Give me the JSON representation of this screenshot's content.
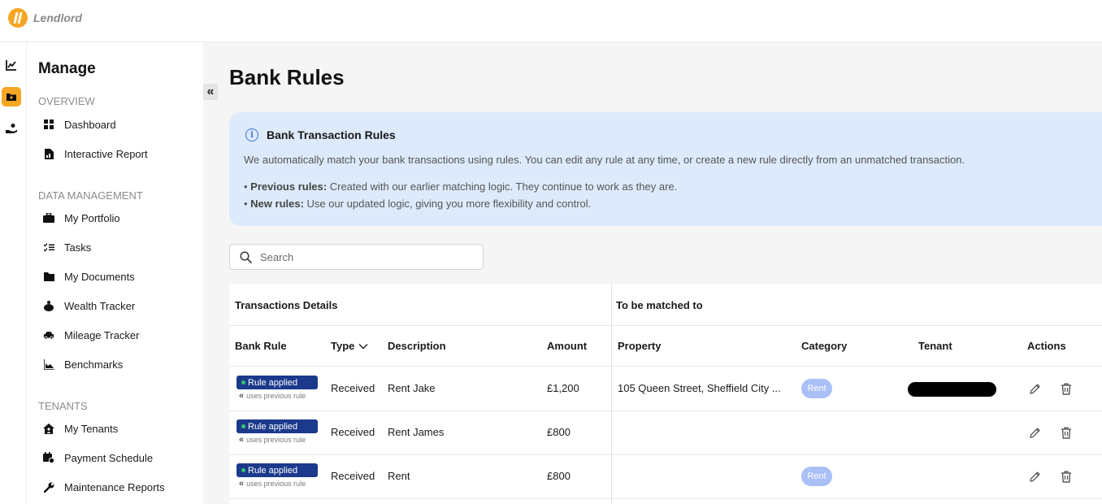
{
  "app": {
    "brand": "Lendlord",
    "brand_color": "#f5a623"
  },
  "rail": {
    "items": [
      {
        "icon": "chart-line-icon",
        "active": false
      },
      {
        "icon": "folder-icon",
        "active": true
      },
      {
        "icon": "hand-coin-icon",
        "active": false
      }
    ]
  },
  "sidebar": {
    "title": "Manage",
    "sections": [
      {
        "label": "OVERVIEW",
        "items": [
          {
            "label": "Dashboard",
            "icon": "grid-icon"
          },
          {
            "label": "Interactive Report",
            "icon": "report-icon"
          }
        ]
      },
      {
        "label": "DATA MANAGEMENT",
        "items": [
          {
            "label": "My Portfolio",
            "icon": "briefcase-icon"
          },
          {
            "label": "Tasks",
            "icon": "checklist-icon"
          },
          {
            "label": "My Documents",
            "icon": "folder-icon"
          },
          {
            "label": "Wealth Tracker",
            "icon": "piggy-bank-icon"
          },
          {
            "label": "Mileage Tracker",
            "icon": "car-icon"
          },
          {
            "label": "Benchmarks",
            "icon": "area-chart-icon"
          }
        ]
      },
      {
        "label": "TENANTS",
        "items": [
          {
            "label": "My Tenants",
            "icon": "home-user-icon"
          },
          {
            "label": "Payment Schedule",
            "icon": "calendar-icon"
          },
          {
            "label": "Maintenance Reports",
            "icon": "wrench-icon"
          }
        ]
      }
    ]
  },
  "collapse_icon": "«",
  "page": {
    "title": "Bank Rules"
  },
  "info": {
    "icon_glyph": "i",
    "title": "Bank Transaction Rules",
    "description": "We automatically match your bank transactions using rules. You can edit any rule at any time, or create a new rule directly from an unmatched transaction.",
    "bullets": [
      {
        "label": "Previous rules:",
        "text": "Created with our earlier matching logic. They continue to work as they are."
      },
      {
        "label": "New rules:",
        "text": "Use our updated logic, giving you more flexibility and control."
      }
    ]
  },
  "search": {
    "placeholder": "Search"
  },
  "table": {
    "group_left": "Transactions Details",
    "group_right": "To be matched to",
    "columns": {
      "bank_rule": "Bank Rule",
      "type": "Type",
      "description": "Description",
      "amount": "Amount",
      "property": "Property",
      "category": "Category",
      "tenant": "Tenant",
      "actions": "Actions"
    },
    "rows": [
      {
        "badge": "Rule applied",
        "sub": "uses previous rule",
        "type": "Received",
        "description": "Rent Jake",
        "amount": "£1,200",
        "property": "105 Queen Street, Sheffield City ...",
        "category": "Rent",
        "tenant_redacted": true
      },
      {
        "badge": "Rule applied",
        "sub": "uses previous rule",
        "type": "Received",
        "description": "Rent James",
        "amount": "£800",
        "property": "",
        "category": "",
        "tenant_redacted": false
      },
      {
        "badge": "Rule applied",
        "sub": "uses previous rule",
        "type": "Received",
        "description": "Rent",
        "amount": "£800",
        "property": "",
        "category": "Rent",
        "tenant_redacted": false
      }
    ]
  }
}
